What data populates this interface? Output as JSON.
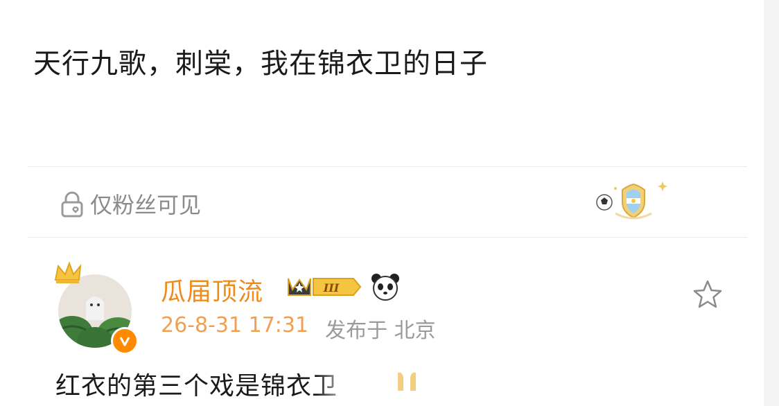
{
  "post": {
    "text": "天行九歌，刺棠，我在锦衣卫的日子"
  },
  "visibility": {
    "label": "仅粉丝可见"
  },
  "comment": {
    "username": "瓜届顶流",
    "level_badge": "III",
    "timestamp": "26-8-31 17:31",
    "location": "发布于 北京",
    "text": "红衣的第三个戏是锦衣卫"
  },
  "icons": {
    "visibility": "lock-heart-icon",
    "badge": "football-shield-badge-icon",
    "crown": "crown-icon",
    "verified": "verified-v-icon",
    "panda": "panda-icon",
    "like": "star-icon"
  },
  "colors": {
    "username": "#f08b1a",
    "timestamp": "#f0a050",
    "meta": "#9a9a9a",
    "text": "#1a1a1a",
    "verified": "#ff8a00"
  }
}
